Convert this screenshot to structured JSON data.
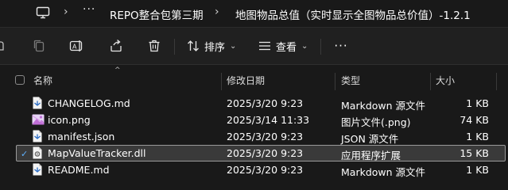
{
  "breadcrumb": {
    "more": "···",
    "parent": "REPO整合包第三期",
    "current": "地图物品总值（实时显示全图物品总价值）-1.2.1"
  },
  "toolbar": {
    "sort_label": "排序",
    "view_label": "查看",
    "more_label": "···"
  },
  "columns": {
    "name": "名称",
    "modified": "修改日期",
    "type": "类型",
    "size": "大小"
  },
  "files": [
    {
      "name": "CHANGELOG.md",
      "modified": "2025/3/20 9:23",
      "type": "Markdown 源文件",
      "size": "1 KB",
      "icon": "markdown-file-icon",
      "selected": false
    },
    {
      "name": "icon.png",
      "modified": "2025/3/14 11:33",
      "type": "图片文件(.png)",
      "size": "74 KB",
      "icon": "image-file-icon",
      "selected": false
    },
    {
      "name": "manifest.json",
      "modified": "2025/3/20 9:23",
      "type": "JSON 源文件",
      "size": "1 KB",
      "icon": "json-file-icon",
      "selected": false
    },
    {
      "name": "MapValueTracker.dll",
      "modified": "2025/3/20 9:23",
      "type": "应用程序扩展",
      "size": "15 KB",
      "icon": "dll-file-icon",
      "selected": true
    },
    {
      "name": "README.md",
      "modified": "2025/3/20 9:23",
      "type": "Markdown 源文件",
      "size": "1 KB",
      "icon": "markdown-file-icon",
      "selected": false
    }
  ]
}
